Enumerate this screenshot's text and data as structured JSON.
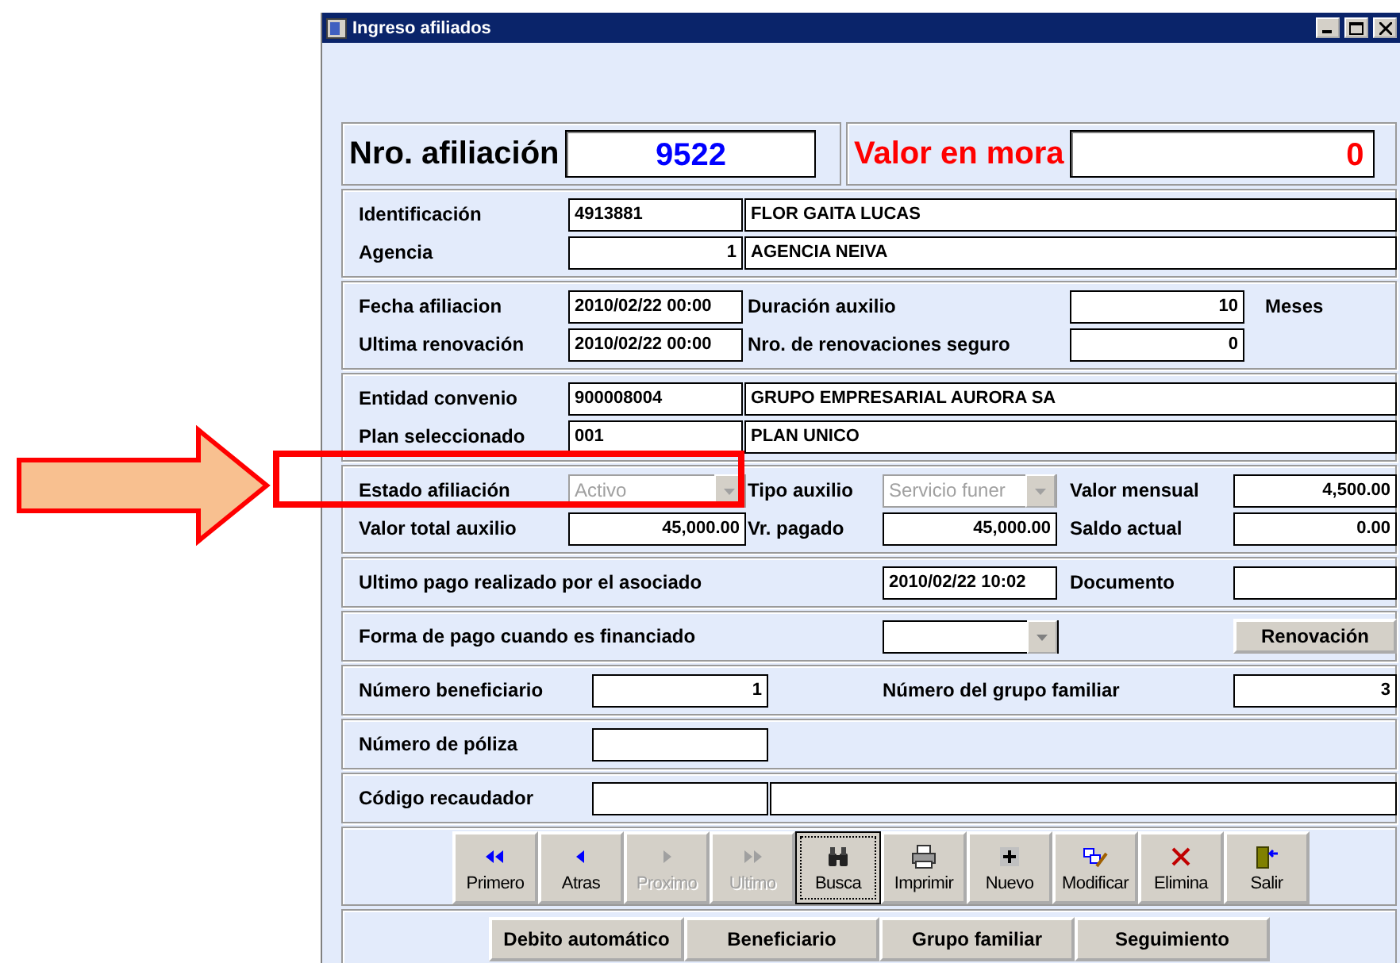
{
  "window": {
    "title": "Ingreso afiliados"
  },
  "header": {
    "number_label": "Nro. afiliación",
    "number": "9522",
    "arrears_label": "Valor en mora",
    "arrears": "0"
  },
  "sections": [
    {
      "rows": [
        [
          {
            "kind": "label",
            "text": "Identificación"
          },
          {
            "kind": "field",
            "value": "4913881"
          },
          {
            "kind": "field",
            "value": "FLOR GAITA LUCAS"
          }
        ],
        [
          {
            "kind": "label",
            "text": "Agencia"
          },
          {
            "kind": "number",
            "value": "1"
          },
          {
            "kind": "field",
            "value": "AGENCIA NEIVA"
          }
        ]
      ]
    },
    {
      "rows": [
        [
          {
            "kind": "label",
            "text": "Fecha afiliacion"
          },
          {
            "kind": "field",
            "value": "2010/02/22 00:00"
          },
          {
            "kind": "label",
            "text": "Duración auxilio"
          },
          {
            "kind": "number",
            "value": "10"
          },
          {
            "kind": "label",
            "text": "Meses"
          }
        ],
        [
          {
            "kind": "label",
            "text": "Ultima renovación"
          },
          {
            "kind": "field",
            "value": "2010/02/22 00:00"
          },
          {
            "kind": "label",
            "text": "Nro. de renovaciones seguro"
          },
          {
            "kind": "number",
            "value": "0"
          }
        ]
      ]
    },
    {
      "rows": [
        [
          {
            "kind": "label",
            "text": "Entidad convenio"
          },
          {
            "kind": "field",
            "value": "900008004"
          },
          {
            "kind": "field",
            "value": "GRUPO EMPRESARIAL AURORA SA"
          }
        ],
        [
          {
            "kind": "label",
            "text": "Plan seleccionado"
          },
          {
            "kind": "field",
            "value": "001"
          },
          {
            "kind": "field",
            "value": "PLAN UNICO"
          }
        ]
      ]
    },
    {
      "rows": [
        [
          {
            "kind": "label",
            "text": "Estado afiliación"
          },
          {
            "kind": "combo",
            "value": "Activo",
            "disabled": true
          },
          {
            "kind": "label",
            "text": "Tipo auxilio"
          },
          {
            "kind": "combo",
            "value": "Servicio funer",
            "disabled": true
          },
          {
            "kind": "label",
            "text": "Valor mensual"
          },
          {
            "kind": "number",
            "value": "4,500.00"
          }
        ],
        [
          {
            "kind": "label",
            "text": "Valor total auxilio"
          },
          {
            "kind": "number",
            "value": "45,000.00"
          },
          {
            "kind": "label",
            "text": "Vr. pagado"
          },
          {
            "kind": "number",
            "value": "45,000.00"
          },
          {
            "kind": "label",
            "text": "Saldo actual"
          },
          {
            "kind": "number",
            "value": "0.00"
          }
        ]
      ]
    },
    {
      "rows": [
        [
          {
            "kind": "label",
            "text": "Ultimo pago realizado por el asociado"
          },
          {
            "kind": "field",
            "value": "2010/02/22 10:02"
          },
          {
            "kind": "label",
            "text": "Documento"
          },
          {
            "kind": "field"
          }
        ]
      ]
    },
    {
      "rows": [
        [
          {
            "kind": "label",
            "text": "Forma de pago cuando es financiado"
          },
          {
            "kind": "combo",
            "disabled": false
          },
          {
            "kind": "button",
            "label": "Renovación"
          }
        ]
      ]
    },
    {
      "rows": [
        [
          {
            "kind": "label",
            "text": "Número beneficiario"
          },
          {
            "kind": "number",
            "value": "1"
          },
          {
            "kind": "label",
            "text": "Número del grupo familiar"
          },
          {
            "kind": "number",
            "value": "3"
          }
        ]
      ]
    },
    {
      "rows": [
        [
          {
            "kind": "label",
            "text": "Número de póliza"
          },
          {
            "kind": "field"
          }
        ]
      ]
    },
    {
      "rows": [
        [
          {
            "kind": "label",
            "text": "Código recaudador"
          },
          {
            "kind": "field"
          },
          {
            "kind": "field"
          }
        ]
      ]
    }
  ],
  "toolbar": [
    {
      "kind": "first",
      "label": "Primero",
      "disabled": false,
      "focused": false
    },
    {
      "kind": "previous",
      "label": "Atras",
      "disabled": false,
      "focused": false
    },
    {
      "kind": "next",
      "label": "Proximo",
      "disabled": true,
      "focused": false
    },
    {
      "kind": "last",
      "label": "Ultimo",
      "disabled": true,
      "focused": false
    },
    {
      "kind": "search",
      "label": "Busca",
      "disabled": false,
      "focused": true
    },
    {
      "kind": "print",
      "label": "Imprimir",
      "disabled": false,
      "focused": false
    },
    {
      "kind": "new",
      "label": "Nuevo",
      "disabled": false,
      "focused": false
    },
    {
      "kind": "edit",
      "label": "Modificar",
      "disabled": false,
      "focused": false
    },
    {
      "kind": "delete",
      "label": "Elimina",
      "disabled": false,
      "focused": false
    },
    {
      "kind": "exit",
      "label": "Salir",
      "disabled": false,
      "focused": false
    }
  ],
  "bottom_buttons": [
    "Debito automático",
    "Beneficiario",
    "Grupo familiar",
    "Seguimiento"
  ]
}
